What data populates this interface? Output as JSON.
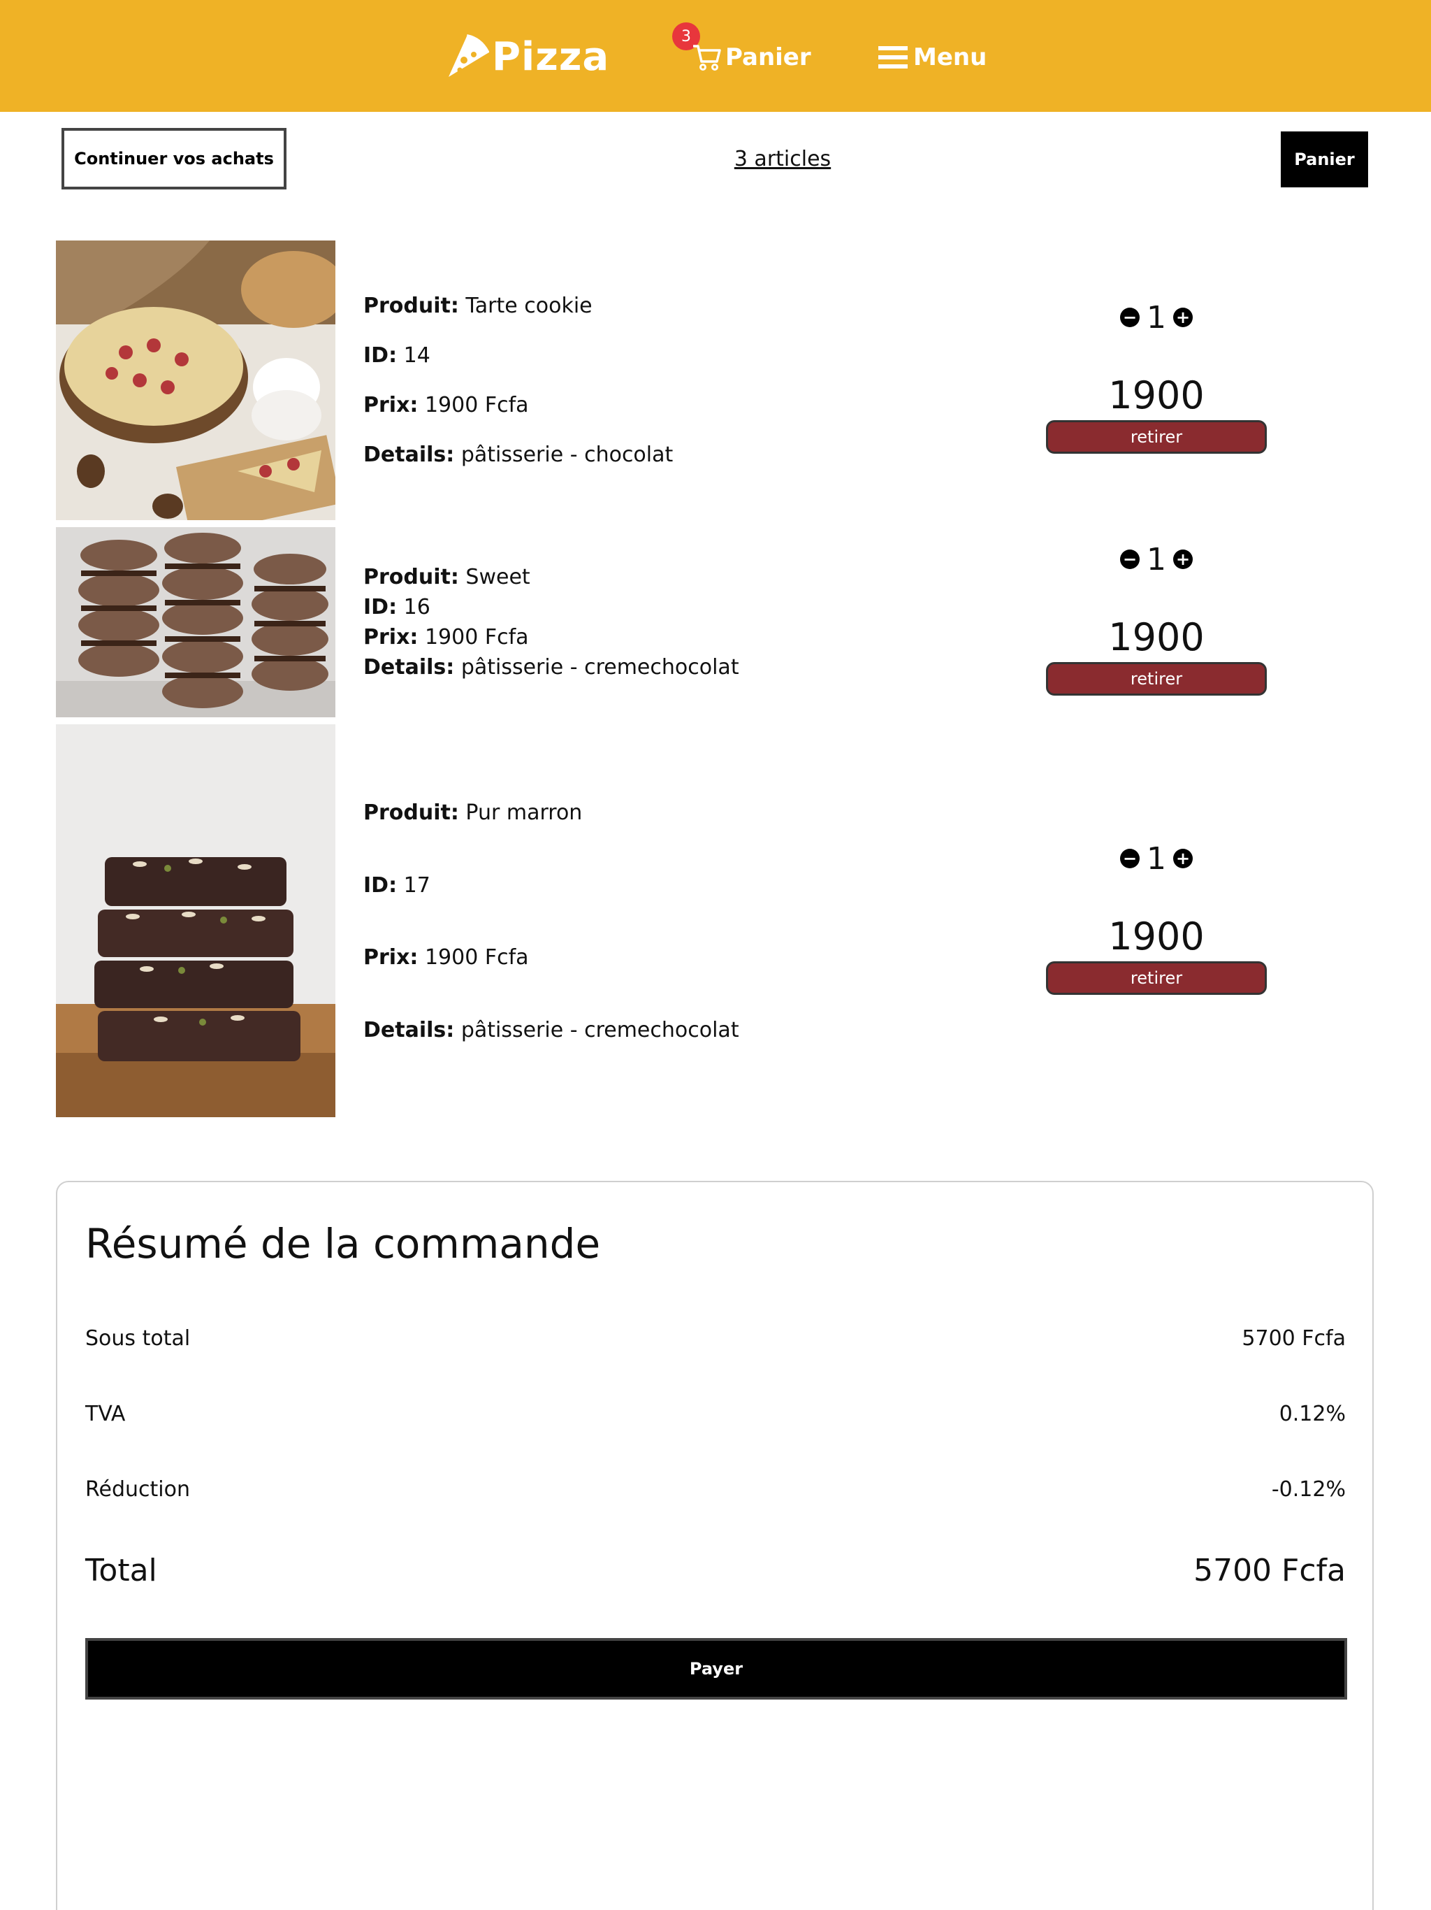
{
  "header": {
    "brand": "Pizza",
    "cart_label": "Panier",
    "cart_count": "3",
    "menu_label": "Menu"
  },
  "toolbar": {
    "continue_label": "Continuer vos achats",
    "articles_label": "3 articles",
    "cart_button_label": "Panier"
  },
  "labels": {
    "product": "Produit:",
    "id": "ID:",
    "price": "Prix:",
    "details": "Details:",
    "remove": "retirer"
  },
  "products": [
    {
      "name": "Tarte cookie",
      "id": "14",
      "price_text": "1900 Fcfa",
      "details": "pâtisserie - chocolat",
      "quantity": "1",
      "line_total": "1900"
    },
    {
      "name": "Sweet",
      "id": "16",
      "price_text": "1900 Fcfa",
      "details": "pâtisserie - cremechocolat",
      "quantity": "1",
      "line_total": "1900"
    },
    {
      "name": "Pur marron",
      "id": "17",
      "price_text": "1900 Fcfa",
      "details": "pâtisserie - cremechocolat",
      "quantity": "1",
      "line_total": "1900"
    }
  ],
  "summary": {
    "title": "Résumé de la commande",
    "subtotal_label": "Sous total",
    "subtotal_value": "5700 Fcfa",
    "tva_label": "TVA",
    "tva_value": "0.12%",
    "discount_label": "Réduction",
    "discount_value": "-0.12%",
    "total_label": "Total",
    "total_value": "5700 Fcfa",
    "pay_label": "Payer"
  },
  "colors": {
    "header_bg": "#efb226",
    "badge": "#e8363c",
    "remove_button": "#8a2b2f"
  }
}
